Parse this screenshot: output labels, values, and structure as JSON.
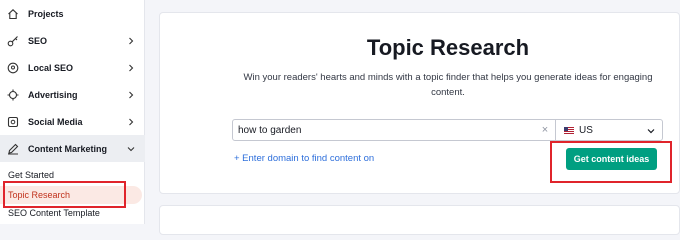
{
  "sidebar": {
    "items": [
      {
        "label": "Projects",
        "icon": "home-icon",
        "has_chevron": false
      },
      {
        "label": "SEO",
        "icon": "key-icon",
        "has_chevron": true
      },
      {
        "label": "Local SEO",
        "icon": "location-pin-icon",
        "has_chevron": true
      },
      {
        "label": "Advertising",
        "icon": "target-icon",
        "has_chevron": true
      },
      {
        "label": "Social Media",
        "icon": "social-icon",
        "has_chevron": true
      },
      {
        "label": "Content Marketing",
        "icon": "pen-icon",
        "has_chevron": true,
        "expanded": true
      }
    ],
    "subitems": [
      {
        "label": "Get Started"
      },
      {
        "label": "Topic Research",
        "selected": true
      },
      {
        "label": "SEO Content Template"
      }
    ]
  },
  "main": {
    "title": "Topic Research",
    "subtitle": "Win your readers' hearts and minds with a topic finder that helps you generate ideas for engaging content.",
    "search": {
      "value": "how to garden",
      "placeholder": ""
    },
    "clear_symbol": "×",
    "country": {
      "label": "US",
      "icon": "us-flag-icon"
    },
    "add_domain_link": "+ Enter domain to find content on",
    "cta_label": "Get content ideas"
  },
  "colors": {
    "accent": "#009f81",
    "link": "#2e6fdb",
    "highlight": "#e0242b",
    "selected_bg": "#fbe9e4"
  }
}
